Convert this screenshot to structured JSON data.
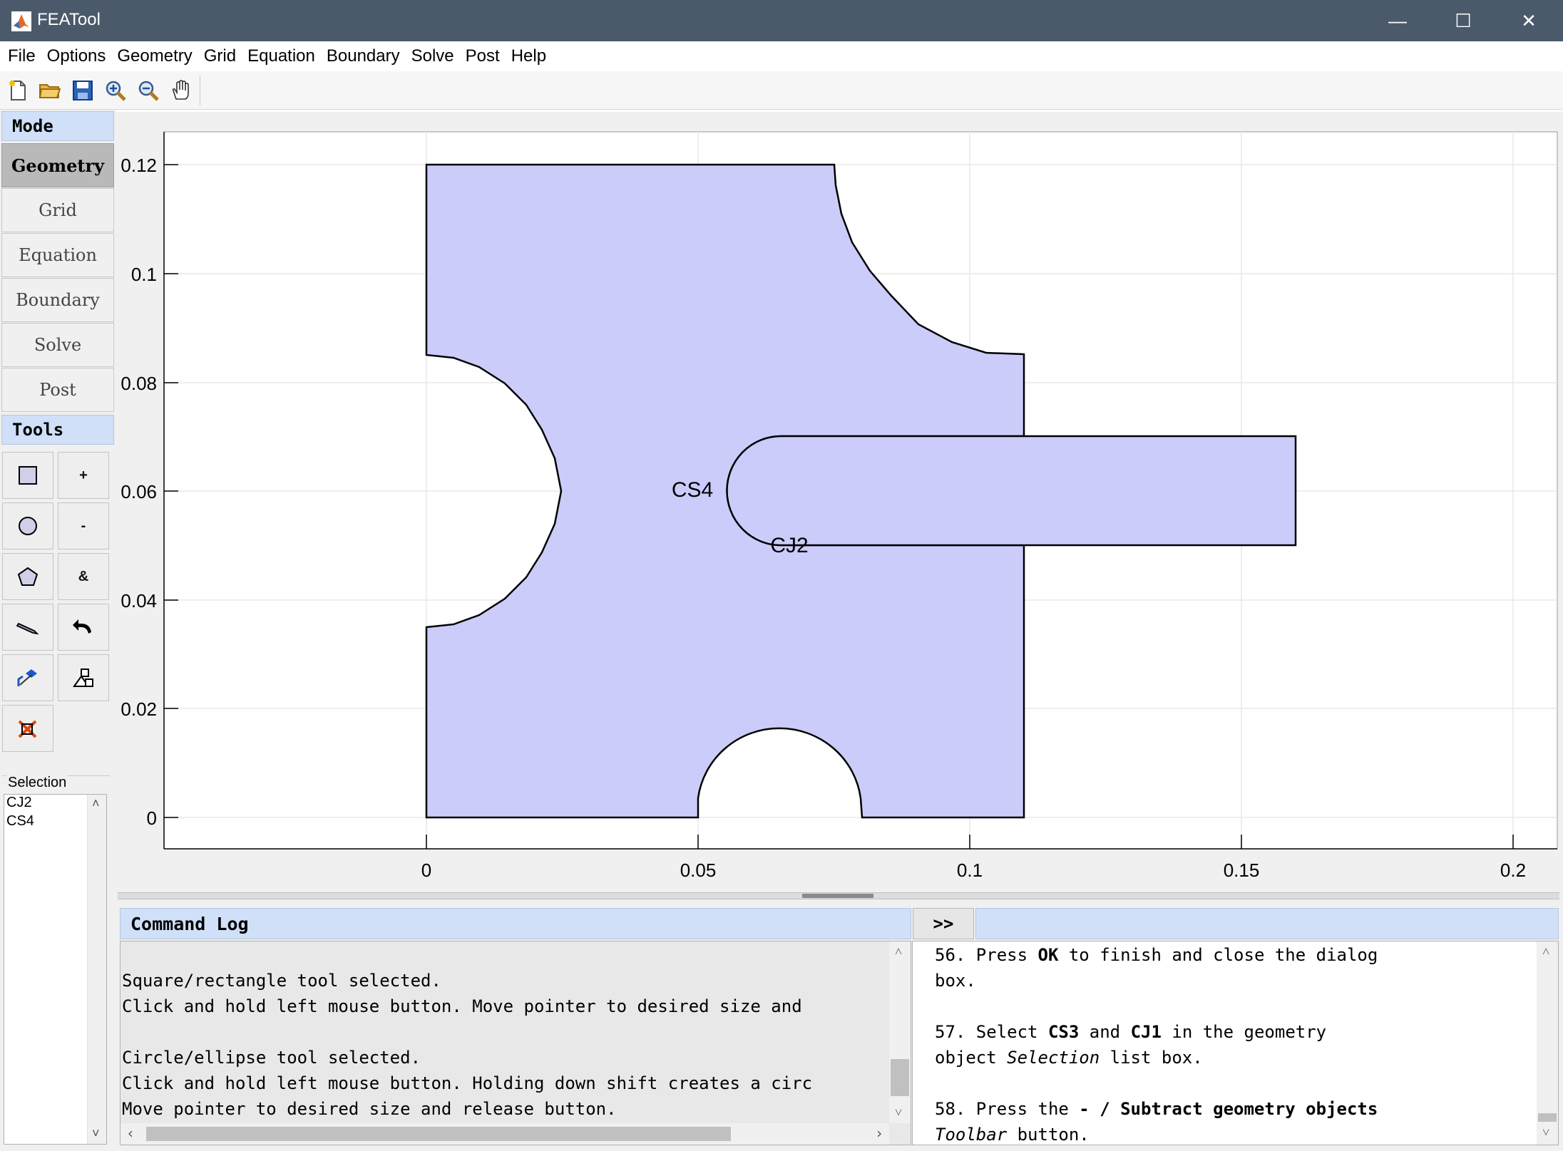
{
  "window": {
    "title": "FEATool",
    "minimize": "—",
    "maximize": "☐",
    "close": "✕"
  },
  "menu": [
    "File",
    "Options",
    "Geometry",
    "Grid",
    "Equation",
    "Boundary",
    "Solve",
    "Post",
    "Help"
  ],
  "toolbar": [
    "new-file-icon",
    "open-folder-icon",
    "save-icon",
    "zoom-in-icon",
    "zoom-out-icon",
    "pan-hand-icon"
  ],
  "sidebar": {
    "mode_header": "Mode",
    "modes": [
      "Geometry",
      "Grid",
      "Equation",
      "Boundary",
      "Solve",
      "Post"
    ],
    "active_mode": "Geometry",
    "tools_header": "Tools",
    "tools": {
      "plus": "+",
      "minus": "-",
      "amp": "&"
    },
    "selection_label": "Selection",
    "selection_items": [
      "CJ2",
      "CS4"
    ]
  },
  "plot": {
    "y_ticks": [
      "0.12",
      "0.1",
      "0.08",
      "0.06",
      "0.04",
      "0.02",
      "0"
    ],
    "x_ticks": [
      "0",
      "0.05",
      "0.1",
      "0.15",
      "0.2"
    ],
    "labels": {
      "cs4": "CS4",
      "cj2": "CJ2"
    },
    "fill_color": "#ccccfa"
  },
  "command_log": {
    "header": "Command Log",
    "toggle": ">>",
    "lines": [
      "",
      "Square/rectangle tool selected.",
      "Click and hold left mouse button. Move pointer to desired size and",
      "",
      "Circle/ellipse tool selected.",
      "Click and hold left mouse button. Holding down shift creates a circ",
      "Move pointer to desired size and release button."
    ]
  },
  "help": {
    "p1a": "56. Press ",
    "p1b": "OK",
    "p1c": " to finish and close the dialog",
    "p1d": "box.",
    "p2a": "57. Select ",
    "p2b": "CS3",
    "p2c": " and ",
    "p2d": "CJ1",
    "p2e": " in the geometry",
    "p2f": "object ",
    "p2g": "Selection",
    "p2h": " list box.",
    "p3a": "58. Press the ",
    "p3b": "- / Subtract geometry objects",
    "p3c": "Toolbar",
    "p3d": " button."
  }
}
